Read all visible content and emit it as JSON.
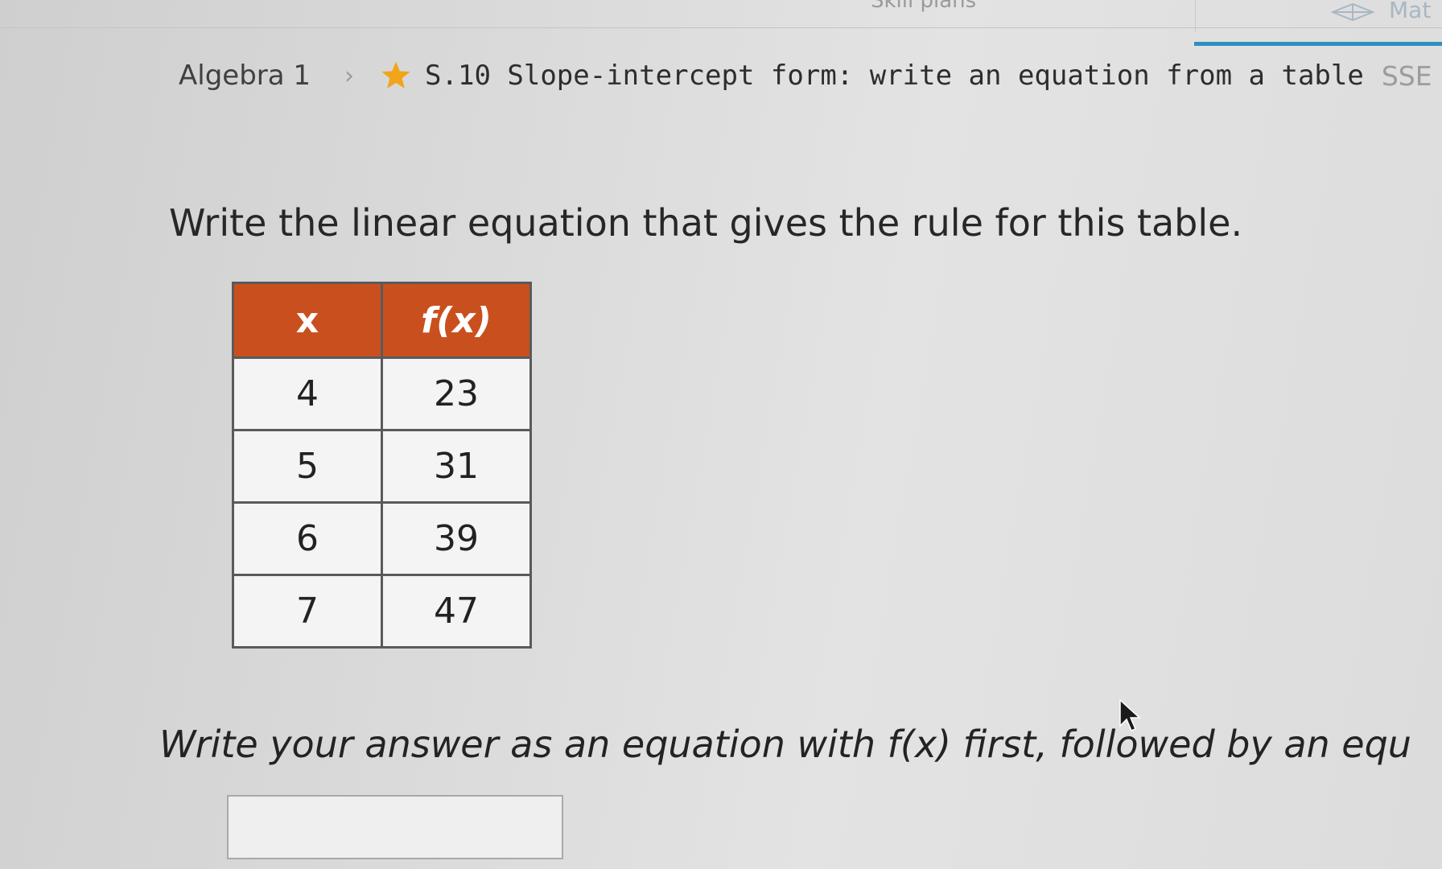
{
  "header": {
    "top_fragment": "Skill plans",
    "top_right_label": "Mat"
  },
  "breadcrumb": {
    "course": "Algebra 1",
    "skill": "S.10 Slope-intercept form: write an equation from a table",
    "skill_code": "SSE"
  },
  "question": {
    "prompt": "Write the linear equation that gives the rule for this table.",
    "table": {
      "headers": [
        "x",
        "f(x)"
      ],
      "rows": [
        [
          "4",
          "23"
        ],
        [
          "5",
          "31"
        ],
        [
          "6",
          "39"
        ],
        [
          "7",
          "47"
        ]
      ]
    },
    "instruction": "Write your answer as an equation with f(x) first, followed by an equ"
  },
  "answer": {
    "value": ""
  },
  "colors": {
    "table_header": "#c9501e",
    "star": "#f2a51a",
    "accent_rule": "#2f8fc1"
  }
}
